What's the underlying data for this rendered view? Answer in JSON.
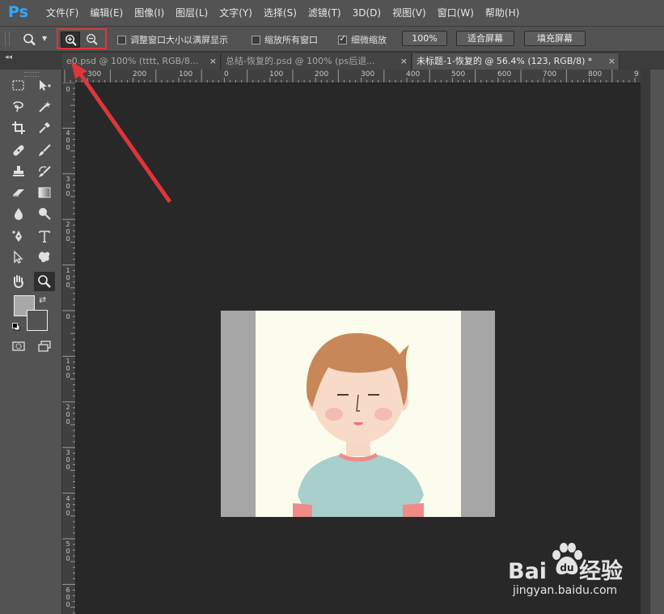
{
  "app": {
    "logo": "Ps"
  },
  "menu": [
    "文件(F)",
    "编辑(E)",
    "图像(I)",
    "图层(L)",
    "文字(Y)",
    "选择(S)",
    "滤镜(T)",
    "3D(D)",
    "视图(V)",
    "窗口(W)",
    "帮助(H)"
  ],
  "options": {
    "resize_windows": "调整窗口大小以满屏显示",
    "resize_windows_checked": false,
    "zoom_all": "缩放所有窗口",
    "zoom_all_checked": false,
    "scrubby": "细微缩放",
    "scrubby_checked": true,
    "btn_100": "100%",
    "btn_fit": "适合屏幕",
    "btn_fill": "填充屏幕",
    "highlight_color": "#e0353b"
  },
  "tabs": [
    {
      "label": "e0.psd @ 100% (tttt, RGB/8...",
      "active": false,
      "close": "×"
    },
    {
      "label": "总结-恢复的.psd @ 100% (ps后退...",
      "active": false,
      "close": "×"
    },
    {
      "label": "未标题-1-恢复的 @ 56.4% (123, RGB/8) *",
      "active": true,
      "close": "×"
    }
  ],
  "ruler": {
    "top": [
      "300",
      "200",
      "100",
      "0",
      "100",
      "200",
      "300",
      "400",
      "500",
      "600",
      "700",
      "800",
      "9"
    ],
    "left": [
      "0",
      "4\n0\n0",
      "3\n0\n0",
      "2\n0\n0",
      "1\n0\n0",
      "0",
      "1\n0\n0",
      "2\n0\n0",
      "3\n0\n0",
      "4\n0\n0",
      "5\n0\n0",
      "6\n0\n0"
    ]
  },
  "tools": [
    "marquee-icon",
    "move-icon",
    "lasso-icon",
    "magic-wand-icon",
    "crop-icon",
    "eyedropper-icon",
    "healing-icon",
    "brush-icon",
    "stamp-icon",
    "history-brush-icon",
    "eraser-icon",
    "gradient-icon",
    "blur-icon",
    "dodge-icon",
    "pen-icon",
    "type-icon",
    "path-select-icon",
    "shape-icon",
    "hand-icon",
    "zoom-icon",
    "quick-mask-icon",
    "screen-mode-icon"
  ],
  "colors": {
    "foreground": "#a8a8a8",
    "background": "#535353",
    "accent": "#e0353b"
  },
  "watermark": {
    "brand": "Bai",
    "brand2": "经验",
    "url": "jingyan.baidu.com"
  }
}
